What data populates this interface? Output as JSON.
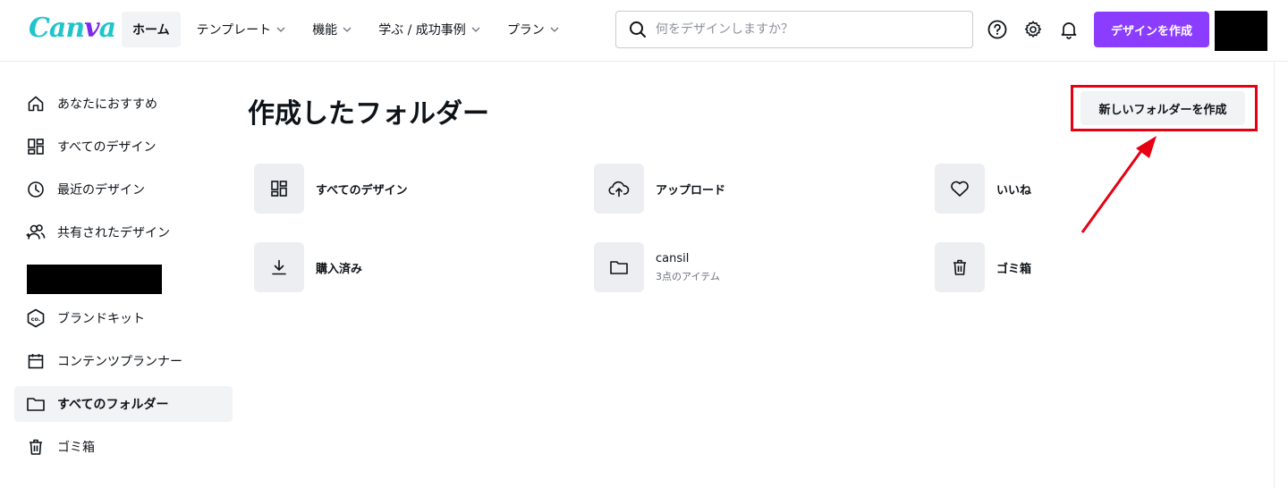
{
  "app": {
    "logo": "Canva"
  },
  "nav": [
    {
      "label": "ホーム",
      "active": true,
      "dropdown": false
    },
    {
      "label": "テンプレート",
      "active": false,
      "dropdown": true
    },
    {
      "label": "機能",
      "active": false,
      "dropdown": true
    },
    {
      "label": "学ぶ / 成功事例",
      "active": false,
      "dropdown": true
    },
    {
      "label": "プラン",
      "active": false,
      "dropdown": true
    }
  ],
  "search": {
    "placeholder": "何をデザインしますか？",
    "icon": "search-icon"
  },
  "header_icons": [
    "help-icon",
    "settings-icon",
    "bell-icon"
  ],
  "create_button": {
    "label": "デザインを作成",
    "color": "#8b3dff"
  },
  "sidebar": {
    "items": [
      {
        "label": "あなたにおすすめ",
        "icon": "home-icon"
      },
      {
        "label": "すべてのデザイン",
        "icon": "grid-icon"
      },
      {
        "label": "最近のデザイン",
        "icon": "clock-icon"
      },
      {
        "label": "共有されたデザイン",
        "icon": "people-icon"
      },
      {
        "label": "ブランドキット",
        "icon": "brand-kit-icon"
      },
      {
        "label": "コンテンツプランナー",
        "icon": "calendar-icon"
      },
      {
        "label": "すべてのフォルダー",
        "icon": "folder-icon",
        "active": true
      },
      {
        "label": "ゴミ箱",
        "icon": "trash-icon"
      }
    ]
  },
  "main": {
    "title": "作成したフォルダー",
    "new_folder_button": "新しいフォルダーを作成",
    "highlight_color": "#e60012",
    "folders": [
      {
        "name": "すべてのデザイン",
        "icon": "grid-icon"
      },
      {
        "name": "アップロード",
        "icon": "cloud-upload-icon"
      },
      {
        "name": "いいね",
        "icon": "heart-icon"
      },
      {
        "name": "購入済み",
        "icon": "download-icon"
      },
      {
        "name": "cansil",
        "sub": "3点のアイテム",
        "icon": "folder-icon"
      },
      {
        "name": "ゴミ箱",
        "icon": "trash-icon"
      }
    ]
  }
}
